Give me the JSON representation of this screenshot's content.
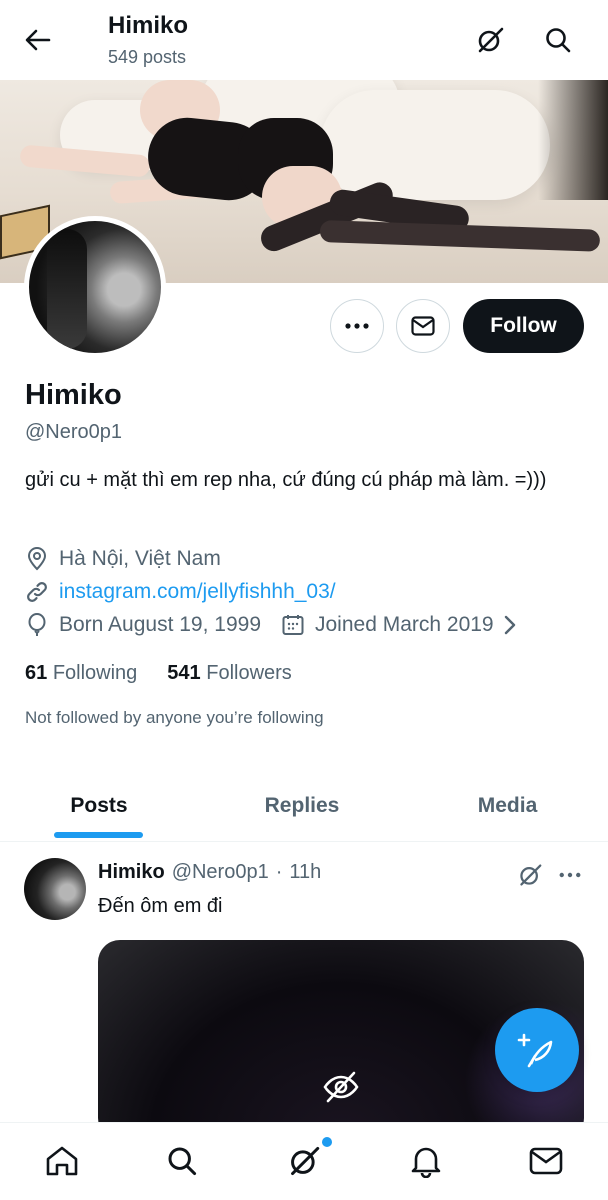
{
  "header": {
    "title": "Himiko",
    "subtitle": "549 posts",
    "back_icon": "arrow-left-icon",
    "grok_icon": "grok-icon",
    "search_icon": "search-icon"
  },
  "profile": {
    "name": "Himiko",
    "handle": "@Nero0p1",
    "bio": "gửi cu + mặt thì em rep nha, cứ đúng cú pháp mà làm. =)))",
    "location": "Hà Nội, Việt Nam",
    "website": "instagram.com/jellyfishhh_03/",
    "born": "Born August 19, 1999",
    "joined": "Joined March 2019",
    "following_count": "61",
    "following_label": "Following",
    "followers_count": "541",
    "followers_label": "Followers",
    "not_followed_note": "Not followed by anyone you’re following",
    "follow_label": "Follow"
  },
  "tabs": [
    {
      "label": "Posts",
      "active": true
    },
    {
      "label": "Replies",
      "active": false
    },
    {
      "label": "Media",
      "active": false
    }
  ],
  "post": {
    "author": "Himiko",
    "handle": "@Nero0p1",
    "separator": "·",
    "time": "11h",
    "text": "Đến ôm em đi",
    "media_hidden_icon": "eye-slash-icon"
  },
  "bottom_nav": [
    "home-icon",
    "search-icon",
    "grok-icon",
    "notifications-icon",
    "messages-icon"
  ],
  "colors": {
    "accent": "#1d9bf0",
    "text": "#0f1419",
    "muted": "#536471"
  }
}
